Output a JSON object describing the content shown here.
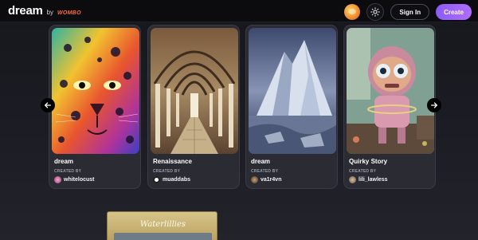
{
  "header": {
    "brand": "dream",
    "by": "by",
    "wombo": "WOMBO",
    "signin_label": "Sign In",
    "create_label": "Create"
  },
  "cards": [
    {
      "title": "dream",
      "created_by": "CREATED BY",
      "user": "whitelocust"
    },
    {
      "title": "Renaissance",
      "created_by": "CREATED BY",
      "user": "muaddabs"
    },
    {
      "title": "dream",
      "created_by": "CREATED BY",
      "user": "va1r4vn"
    },
    {
      "title": "Quirky Story",
      "created_by": "CREATED BY",
      "user": "lili_lawless"
    }
  ],
  "peek": {
    "title": "Waterlillies"
  },
  "colors": {
    "accent": "#a15ef9",
    "card": "#2a2b33",
    "header": "#0c0c0f"
  },
  "icons": [
    "sun-icon",
    "arrow-left-icon",
    "arrow-right-icon"
  ]
}
